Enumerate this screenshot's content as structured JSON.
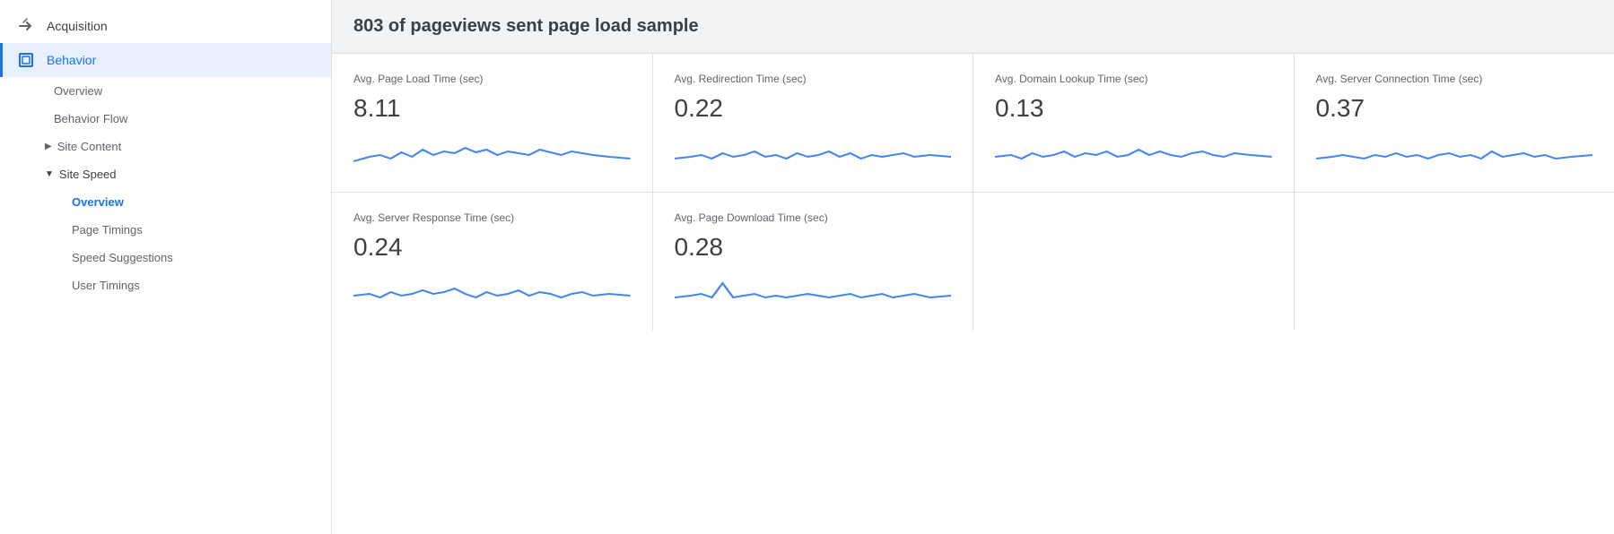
{
  "sidebar": {
    "acquisition": {
      "label": "Acquisition",
      "icon": "→"
    },
    "behavior": {
      "label": "Behavior",
      "active": true
    },
    "sub_items": [
      {
        "label": "Overview",
        "active": false,
        "indent": "sub"
      },
      {
        "label": "Behavior Flow",
        "active": false,
        "indent": "sub"
      },
      {
        "label": "Site Content",
        "active": false,
        "indent": "group",
        "expanded": false
      },
      {
        "label": "Site Speed",
        "active": true,
        "indent": "group",
        "expanded": true
      },
      {
        "label": "Overview",
        "active": true,
        "indent": "deep"
      },
      {
        "label": "Page Timings",
        "active": false,
        "indent": "deep"
      },
      {
        "label": "Speed Suggestions",
        "active": false,
        "indent": "deep"
      },
      {
        "label": "User Timings",
        "active": false,
        "indent": "deep"
      }
    ]
  },
  "header": {
    "title": "803 of pageviews sent page load sample"
  },
  "metrics": [
    {
      "label": "Avg. Page Load Time (sec)",
      "value": "8.11",
      "chart_id": "chart1"
    },
    {
      "label": "Avg. Redirection Time (sec)",
      "value": "0.22",
      "chart_id": "chart2"
    },
    {
      "label": "Avg. Domain Lookup Time (sec)",
      "value": "0.13",
      "chart_id": "chart3"
    },
    {
      "label": "Avg. Server Connection Time (sec)",
      "value": "0.37",
      "chart_id": "chart4"
    },
    {
      "label": "Avg. Server Response Time (sec)",
      "value": "0.24",
      "chart_id": "chart5"
    },
    {
      "label": "Avg. Page Download Time (sec)",
      "value": "0.28",
      "chart_id": "chart6"
    }
  ],
  "icons": {
    "acquisition_arrow": "➔",
    "behavior_square": "▣",
    "triangle_right": "▶",
    "triangle_down": "▼"
  }
}
